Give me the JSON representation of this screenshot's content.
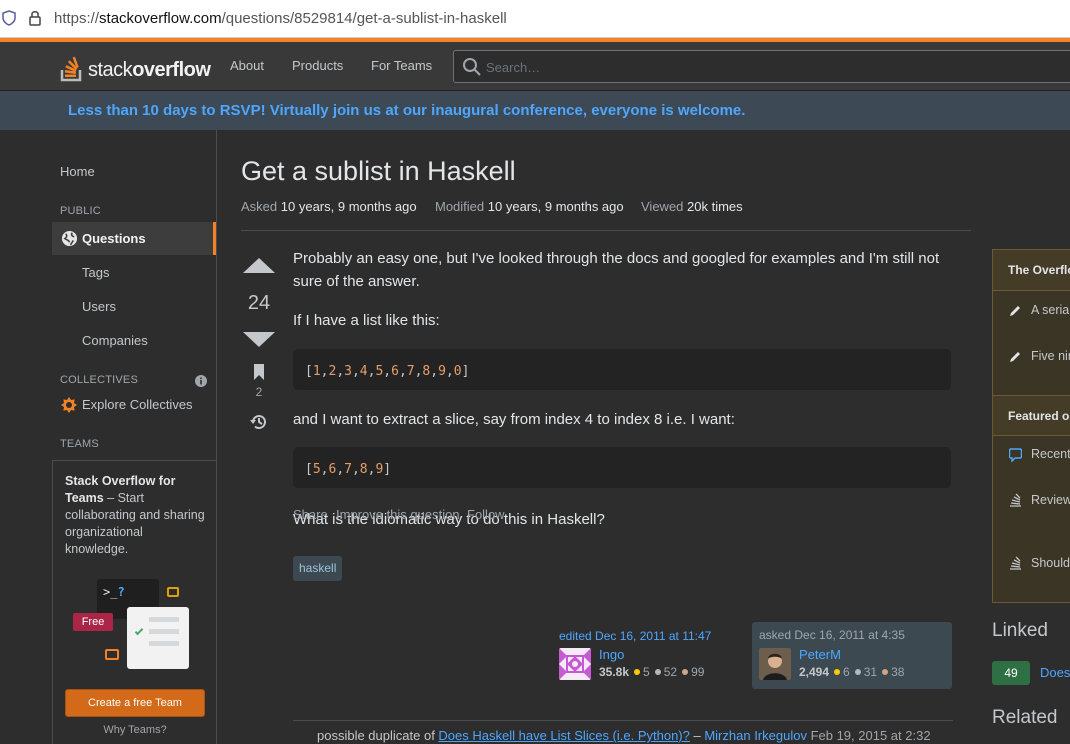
{
  "browser": {
    "url_scheme": "https://",
    "url_host": "stackoverflow.com",
    "url_path": "/questions/8529814/get-a-sublist-in-haskell"
  },
  "header": {
    "logo_text_light": "stack",
    "logo_text_bold": "overflow",
    "nav": [
      "About",
      "Products",
      "For Teams"
    ],
    "search_placeholder": "Search…"
  },
  "banner": {
    "message": "Less than 10 days to RSVP! Virtually join us at our inaugural conference, everyone is welcome."
  },
  "leftnav": {
    "home": "Home",
    "public_label": "PUBLIC",
    "questions": "Questions",
    "tags": "Tags",
    "users": "Users",
    "companies": "Companies",
    "collectives_label": "COLLECTIVES",
    "explore_collectives": "Explore Collectives",
    "teams_label": "TEAMS",
    "teams_title": "Stack Overflow for Teams",
    "teams_text": " – Start collaborating and sharing organizational knowledge.",
    "free_badge": "Free",
    "create_team": "Create a free Team",
    "why_teams": "Why Teams?"
  },
  "question": {
    "title": "Get a sublist in Haskell",
    "asked_label": "Asked",
    "asked_value": "10 years, 9 months ago",
    "modified_label": "Modified",
    "modified_value": "10 years, 9 months ago",
    "viewed_label": "Viewed",
    "viewed_value": "20k times",
    "score": "24",
    "bookmarks": "2",
    "para1": "Probably an easy one, but I've looked through the docs and googled for examples and I'm still not sure of the answer.",
    "para2": "If I have a list like this:",
    "code1": [
      "1",
      "2",
      "3",
      "4",
      "5",
      "6",
      "7",
      "8",
      "9",
      "0"
    ],
    "para3": "and I want to extract a slice, say from index 4 to index 8 i.e. I want:",
    "code2": [
      "5",
      "6",
      "7",
      "8",
      "9"
    ],
    "para4": "What is the idiomatic way to do this in Haskell?",
    "tag": "haskell",
    "actions": [
      "Share",
      "Improve this question",
      "Follow"
    ]
  },
  "edited": {
    "label": "edited Dec 16, 2011 at 11:47",
    "name": "Ingo",
    "rep": "35.8k",
    "gold": "5",
    "silver": "52",
    "bronze": "99"
  },
  "asked": {
    "label": "asked Dec 16, 2011 at 4:35",
    "name": "PeterM",
    "rep": "2,494",
    "gold": "6",
    "silver": "31",
    "bronze": "38"
  },
  "comment": {
    "prefix": "possible duplicate of ",
    "link": "Does Haskell have List Slices (i.e. Python)?",
    "sep": " – ",
    "user": "Mirzhan Irkegulov",
    "date": " Feb 19, 2015 at 2:32"
  },
  "sidebar": {
    "overflow_title": "The Overflow Blog",
    "overflow_items": [
      "A serial entrepreneur finally embraces open source",
      "Five nines of burnout"
    ],
    "featured_title": "Featured on Meta",
    "featured_items": [
      "Recent Color Contrast Changes and Accessibility",
      "Reviewer overboard! Or a request to improve the onboarding guidance for new...",
      "Should we burninate the [choose] tag? answers"
    ],
    "linked_title": "Linked",
    "linked_count": "49",
    "linked_question": "Does",
    "related_title": "Related"
  },
  "colors": {
    "accent": "#f48225",
    "link": "#4ea6ff",
    "gold": "#ffcc01",
    "silver": "#b4b8bc",
    "bronze": "#d1a684"
  }
}
